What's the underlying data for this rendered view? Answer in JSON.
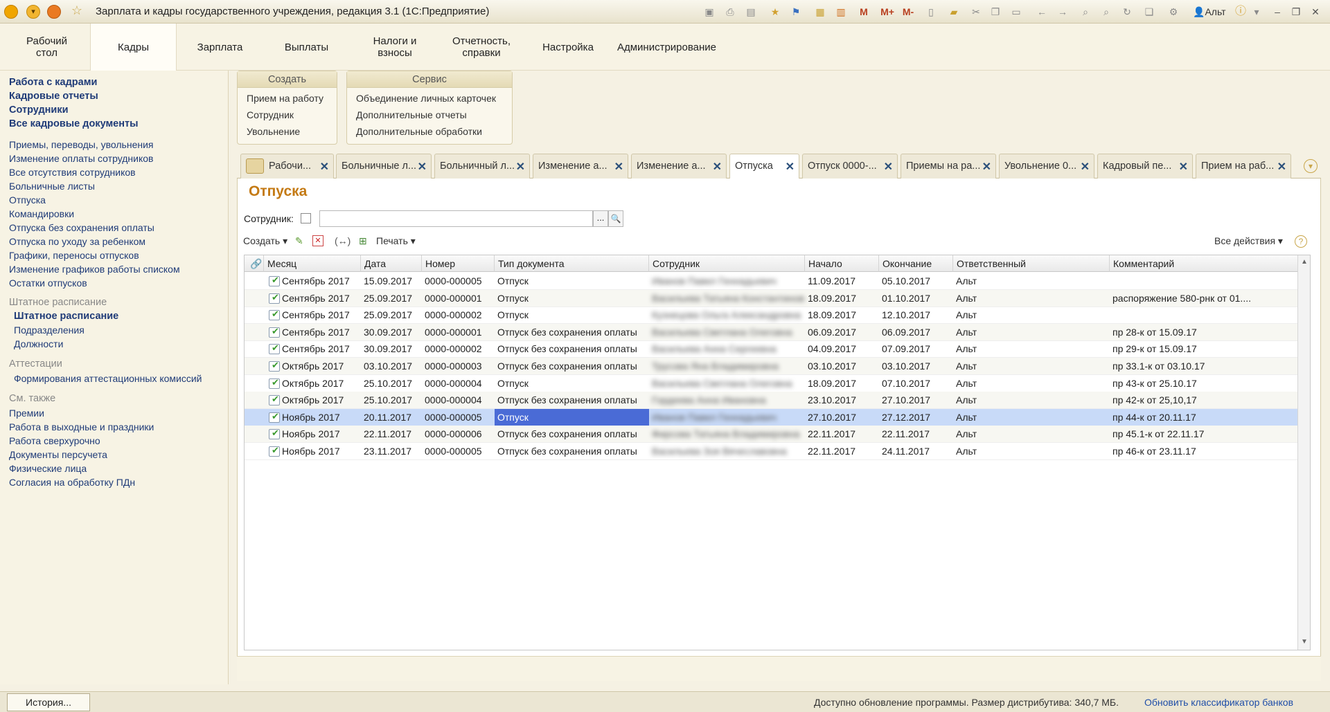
{
  "window": {
    "title": "Зарплата и кадры государственного учреждения, редакция 3.1  (1С:Предприятие)",
    "user": "Альт",
    "memory_buttons": [
      "M",
      "M+",
      "M-"
    ]
  },
  "sections": [
    "Рабочий\nстол",
    "Кадры",
    "Зарплата",
    "Выплаты",
    "Налоги и\nвзносы",
    "Отчетность,\nсправки",
    "Настройка",
    "Администрирование"
  ],
  "nav": {
    "main": [
      "Работа с кадрами",
      "Кадровые отчеты",
      "Сотрудники",
      "Все кадровые документы"
    ],
    "documents": [
      "Приемы, переводы, увольнения",
      "Изменение оплаты сотрудников",
      "Все отсутствия сотрудников",
      "Больничные листы",
      "Отпуска",
      "Командировки",
      "Отпуска без сохранения оплаты",
      "Отпуска по уходу за ребенком",
      "Графики, переносы отпусков",
      "Изменение графиков работы списком",
      "Остатки отпусков"
    ],
    "staff_group": "Штатное расписание",
    "staff_items": [
      "Штатное расписание",
      "Подразделения",
      "Должности"
    ],
    "attest_group": "Аттестации",
    "attest_items": [
      "Формирования аттестационных комиссий"
    ],
    "see_also_group": "См. также",
    "see_also_items": [
      "Премии",
      "Работа в выходные и праздники",
      "Работа сверхурочно",
      "Документы персучета",
      "Физические лица",
      "Согласия на обработку ПДн"
    ]
  },
  "create_box": {
    "header": "Создать",
    "items": [
      "Прием на работу",
      "Сотрудник",
      "Увольнение"
    ]
  },
  "service_box": {
    "header": "Сервис",
    "items": [
      "Объединение личных карточек",
      "Дополнительные отчеты",
      "Дополнительные обработки"
    ]
  },
  "tabs": [
    "Рабочи...",
    "Больничные л...",
    "Больничный л...",
    "Изменение а...",
    "Изменение а...",
    "Отпуска",
    "Отпуск 0000-...",
    "Приемы на ра...",
    "Увольнение 0...",
    "Кадровый пе...",
    "Прием на раб..."
  ],
  "form": {
    "title": "Отпуска",
    "filter_label": "Сотрудник:",
    "filter_value": "",
    "create_label": "Создать ▾",
    "print_label": "Печать ▾",
    "all_actions_label": "Все действия ▾",
    "columns": [
      "Месяц",
      "Дата",
      "Номер",
      "Тип документа",
      "Сотрудник",
      "Начало",
      "Окончание",
      "Ответственный",
      "Комментарий"
    ],
    "rows": [
      {
        "month": "Сентябрь 2017",
        "date": "15.09.2017",
        "number": "0000-000005",
        "type": "Отпуск",
        "employee": "Иванов Павел Геннадьевич",
        "start": "11.09.2017",
        "end": "05.10.2017",
        "resp": "Альт",
        "comment": ""
      },
      {
        "month": "Сентябрь 2017",
        "date": "25.09.2017",
        "number": "0000-000001",
        "type": "Отпуск",
        "employee": "Васильева Татьяна Константиновна",
        "start": "18.09.2017",
        "end": "01.10.2017",
        "resp": "Альт",
        "comment": "распоряжение 580-рнк от 01...."
      },
      {
        "month": "Сентябрь 2017",
        "date": "25.09.2017",
        "number": "0000-000002",
        "type": "Отпуск",
        "employee": "Кузнецова Ольга Александровна",
        "start": "18.09.2017",
        "end": "12.10.2017",
        "resp": "Альт",
        "comment": ""
      },
      {
        "month": "Сентябрь 2017",
        "date": "30.09.2017",
        "number": "0000-000001",
        "type": "Отпуск без сохранения оплаты",
        "employee": "Васильева Светлана Олеговна",
        "start": "06.09.2017",
        "end": "06.09.2017",
        "resp": "Альт",
        "comment": "пр 28-к от 15.09.17"
      },
      {
        "month": "Сентябрь 2017",
        "date": "30.09.2017",
        "number": "0000-000002",
        "type": "Отпуск без сохранения оплаты",
        "employee": "Васильева Анна Сергеевна",
        "start": "04.09.2017",
        "end": "07.09.2017",
        "resp": "Альт",
        "comment": "пр 29-к от 15.09.17"
      },
      {
        "month": "Октябрь 2017",
        "date": "03.10.2017",
        "number": "0000-000003",
        "type": "Отпуск без сохранения оплаты",
        "employee": "Трусова Яна Владимировна",
        "start": "03.10.2017",
        "end": "03.10.2017",
        "resp": "Альт",
        "comment": "пр 33.1-к от 03.10.17"
      },
      {
        "month": "Октябрь 2017",
        "date": "25.10.2017",
        "number": "0000-000004",
        "type": "Отпуск",
        "employee": "Васильева Светлана Олеговна",
        "start": "18.09.2017",
        "end": "07.10.2017",
        "resp": "Альт",
        "comment": "пр 43-к от 25.10.17"
      },
      {
        "month": "Октябрь 2017",
        "date": "25.10.2017",
        "number": "0000-000004",
        "type": "Отпуск без сохранения оплаты",
        "employee": "Гордеева Анна Ивановна",
        "start": "23.10.2017",
        "end": "27.10.2017",
        "resp": "Альт",
        "comment": "пр 42-к от 25,10,17"
      },
      {
        "month": "Ноябрь 2017",
        "date": "20.11.2017",
        "number": "0000-000005",
        "type": "Отпуск",
        "employee": "Иванов Павел Геннадьевич",
        "start": "27.10.2017",
        "end": "27.12.2017",
        "resp": "Альт",
        "comment": "пр 44-к от 20.11.17"
      },
      {
        "month": "Ноябрь 2017",
        "date": "22.11.2017",
        "number": "0000-000006",
        "type": "Отпуск без сохранения оплаты",
        "employee": "Фирсова Татьяна Владимировна",
        "start": "22.11.2017",
        "end": "22.11.2017",
        "resp": "Альт",
        "comment": "пр 45.1-к от 22.11.17"
      },
      {
        "month": "Ноябрь 2017",
        "date": "23.11.2017",
        "number": "0000-000005",
        "type": "Отпуск без сохранения оплаты",
        "employee": "Васильева Зоя Вячеславовна",
        "start": "22.11.2017",
        "end": "24.11.2017",
        "resp": "Альт",
        "comment": "пр 46-к от 23.11.17"
      }
    ]
  },
  "status": {
    "history_button": "История...",
    "update_text": "Доступно обновление программы. Размер дистрибутива: 340,7 МБ.",
    "update_link": "Обновить классификатор банков"
  },
  "colors": {
    "accent": "#c47a14",
    "link": "#1f3b78",
    "selection": "#4a6bd6",
    "row_selected": "#c8daf8"
  }
}
